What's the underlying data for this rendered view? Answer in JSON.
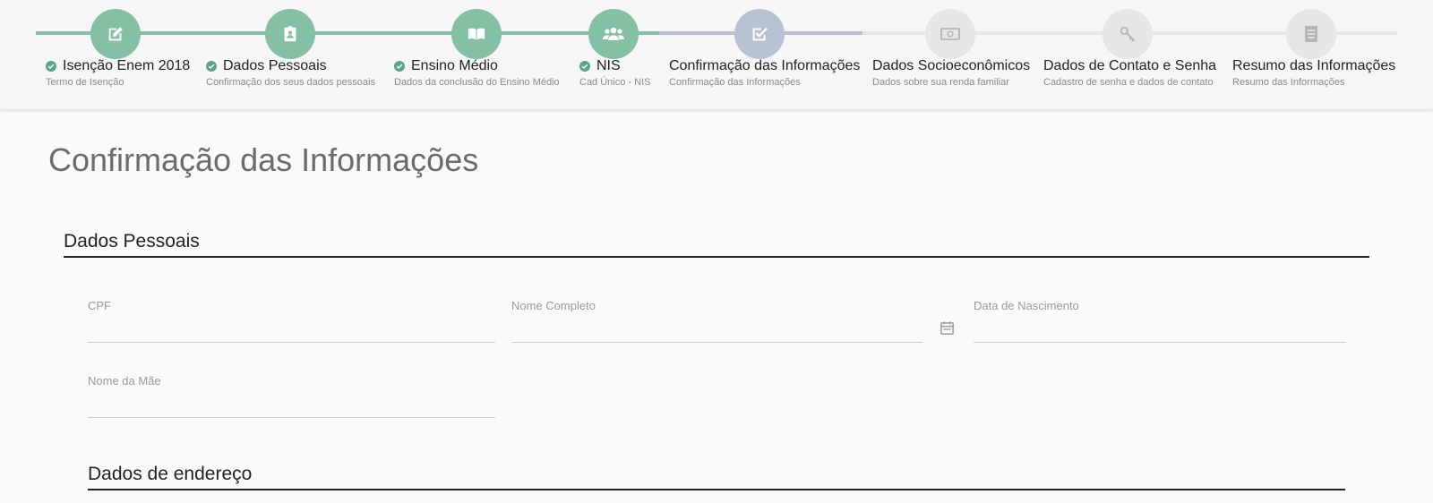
{
  "colors": {
    "completed": "#83c0a4",
    "current": "#b6c2d1",
    "pending": "#e6e6e6",
    "check": "#57a683"
  },
  "steps": [
    {
      "title": "Isenção Enem 2018",
      "subtitle": "Termo de Isenção",
      "status": "completed",
      "icon": "edit-icon"
    },
    {
      "title": "Dados Pessoais",
      "subtitle": "Confirmação dos seus dados pessoais",
      "status": "completed",
      "icon": "id-badge-icon"
    },
    {
      "title": "Ensino Médio",
      "subtitle": "Dados da conclusão do Ensino Médio",
      "status": "completed",
      "icon": "open-book-icon"
    },
    {
      "title": "NIS",
      "subtitle": "Cad Único - NIS",
      "status": "completed",
      "icon": "users-icon"
    },
    {
      "title": "Confirmação das Informações",
      "subtitle": "Confirmação das Informações",
      "status": "current",
      "icon": "checkbox-icon"
    },
    {
      "title": "Dados Socioeconômicos",
      "subtitle": "Dados sobre sua renda familiar",
      "status": "pending",
      "icon": "money-icon"
    },
    {
      "title": "Dados de Contato e Senha",
      "subtitle": "Cadastro de senha e dados de contato",
      "status": "pending",
      "icon": "key-icon"
    },
    {
      "title": "Resumo das Informações",
      "subtitle": "Resumo das Informações",
      "status": "pending",
      "icon": "list-icon"
    }
  ],
  "page": {
    "title": "Confirmação das Informações"
  },
  "sections": {
    "personal": {
      "title": "Dados Pessoais",
      "fields": {
        "cpf": {
          "label": "CPF",
          "value": ""
        },
        "name": {
          "label": "Nome Completo",
          "value": ""
        },
        "birth": {
          "label": "Data de Nascimento",
          "value": ""
        },
        "mother": {
          "label": "Nome da Mãe",
          "value": ""
        }
      }
    },
    "address": {
      "title": "Dados de endereço"
    }
  }
}
